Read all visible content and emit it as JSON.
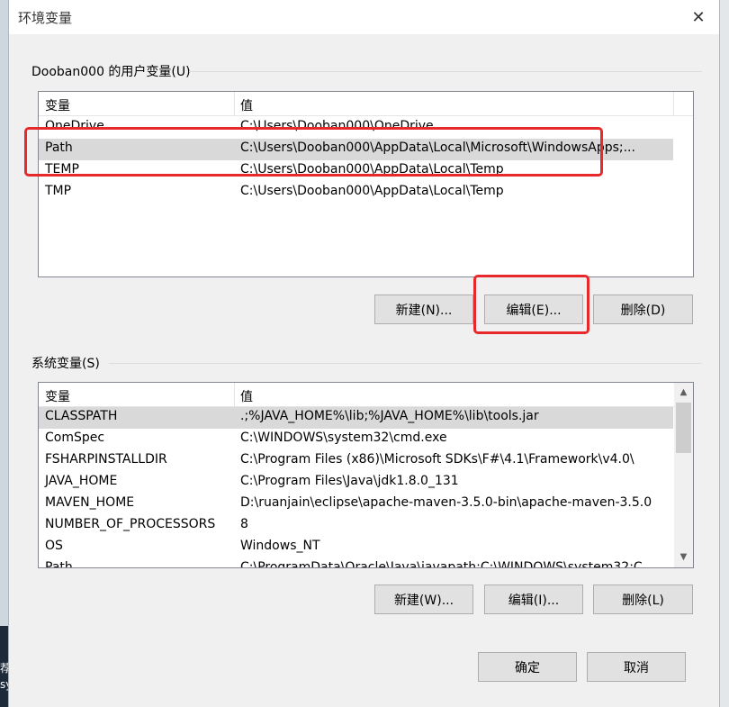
{
  "dialog": {
    "title": "环境变量",
    "close_icon": "close-icon"
  },
  "user_vars": {
    "group_label": "Dooban000 的用户变量(U)",
    "columns": [
      "变量",
      "值"
    ],
    "rows": [
      {
        "name": "OneDrive",
        "value": "C:\\Users\\Dooban000\\OneDrive"
      },
      {
        "name": "Path",
        "value": "C:\\Users\\Dooban000\\AppData\\Local\\Microsoft\\WindowsApps;...",
        "selected": true
      },
      {
        "name": "TEMP",
        "value": "C:\\Users\\Dooban000\\AppData\\Local\\Temp"
      },
      {
        "name": "TMP",
        "value": "C:\\Users\\Dooban000\\AppData\\Local\\Temp"
      }
    ],
    "buttons": {
      "new": "新建(N)...",
      "edit": "编辑(E)...",
      "delete": "删除(D)"
    }
  },
  "system_vars": {
    "group_label": "系统变量(S)",
    "columns": [
      "变量",
      "值"
    ],
    "rows": [
      {
        "name": "CLASSPATH",
        "value": ".;%JAVA_HOME%\\lib;%JAVA_HOME%\\lib\\tools.jar",
        "selected": true
      },
      {
        "name": "ComSpec",
        "value": "C:\\WINDOWS\\system32\\cmd.exe"
      },
      {
        "name": "FSHARPINSTALLDIR",
        "value": "C:\\Program Files (x86)\\Microsoft SDKs\\F#\\4.1\\Framework\\v4.0\\"
      },
      {
        "name": "JAVA_HOME",
        "value": "C:\\Program Files\\Java\\jdk1.8.0_131"
      },
      {
        "name": "MAVEN_HOME",
        "value": "D:\\ruanjain\\eclipse\\apache-maven-3.5.0-bin\\apache-maven-3.5.0"
      },
      {
        "name": "NUMBER_OF_PROCESSORS",
        "value": "8"
      },
      {
        "name": "OS",
        "value": "Windows_NT"
      },
      {
        "name": "Path",
        "value": "C:\\ProgramData\\Oracle\\Java\\javapath;C:\\WINDOWS\\system32;C..."
      }
    ],
    "buttons": {
      "new": "新建(W)...",
      "edit": "编辑(I)...",
      "delete": "删除(L)"
    },
    "scrollbar": {
      "up_icon": "▲",
      "down_icon": "▼"
    }
  },
  "footer": {
    "ok": "确定",
    "cancel": "取消"
  },
  "background": {
    "taskbar_text_1": "荐",
    "taskbar_text_2": "sy"
  },
  "colors": {
    "highlight": "#e8292b",
    "selected_row": "#d9d9d9",
    "dialog_bg": "#f0f0f0"
  }
}
